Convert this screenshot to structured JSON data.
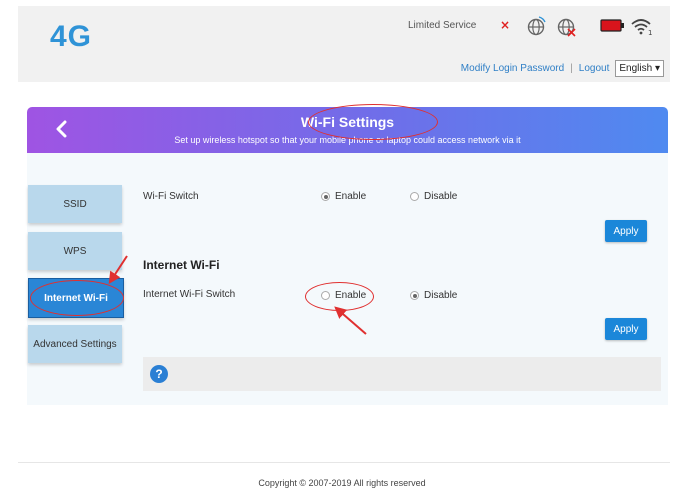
{
  "header": {
    "logo": "4G",
    "status": "Limited Service",
    "icons": [
      "no-sim-x-icon",
      "globe-icon",
      "roaming-globe-icon",
      "battery-icon",
      "wifi-signal-icon"
    ],
    "wifi_badge": "1",
    "links": {
      "modify_password": "Modify Login Password",
      "logout": "Logout",
      "language": "English ▾"
    }
  },
  "banner": {
    "title": "Wi-Fi Settings",
    "subtitle": "Set up wireless hotspot so that your mobile phone or laptop could access network via it",
    "back_icon": "chevron-left-icon"
  },
  "tabs": [
    {
      "label": "SSID",
      "active": false
    },
    {
      "label": "WPS",
      "active": false
    },
    {
      "label": "Internet Wi-Fi",
      "active": true
    },
    {
      "label": "Advanced Settings",
      "active": false
    }
  ],
  "wifi_switch": {
    "label": "Wi-Fi Switch",
    "enable": "Enable",
    "disable": "Disable",
    "selected": "Enable",
    "apply": "Apply"
  },
  "internet_wifi": {
    "title": "Internet Wi-Fi",
    "label": "Internet Wi-Fi Switch",
    "enable": "Enable",
    "disable": "Disable",
    "selected": "Disable",
    "apply": "Apply"
  },
  "help": {
    "icon": "question-icon",
    "glyph": "?"
  },
  "footer": {
    "copyright": "Copyright © 2007-2019 All rights reserved"
  },
  "colors": {
    "accent": "#2f93d7",
    "banner_start": "#9f54e3",
    "banner_end": "#4f8af0",
    "button": "#1b87d9",
    "annotation": "#e03030"
  }
}
